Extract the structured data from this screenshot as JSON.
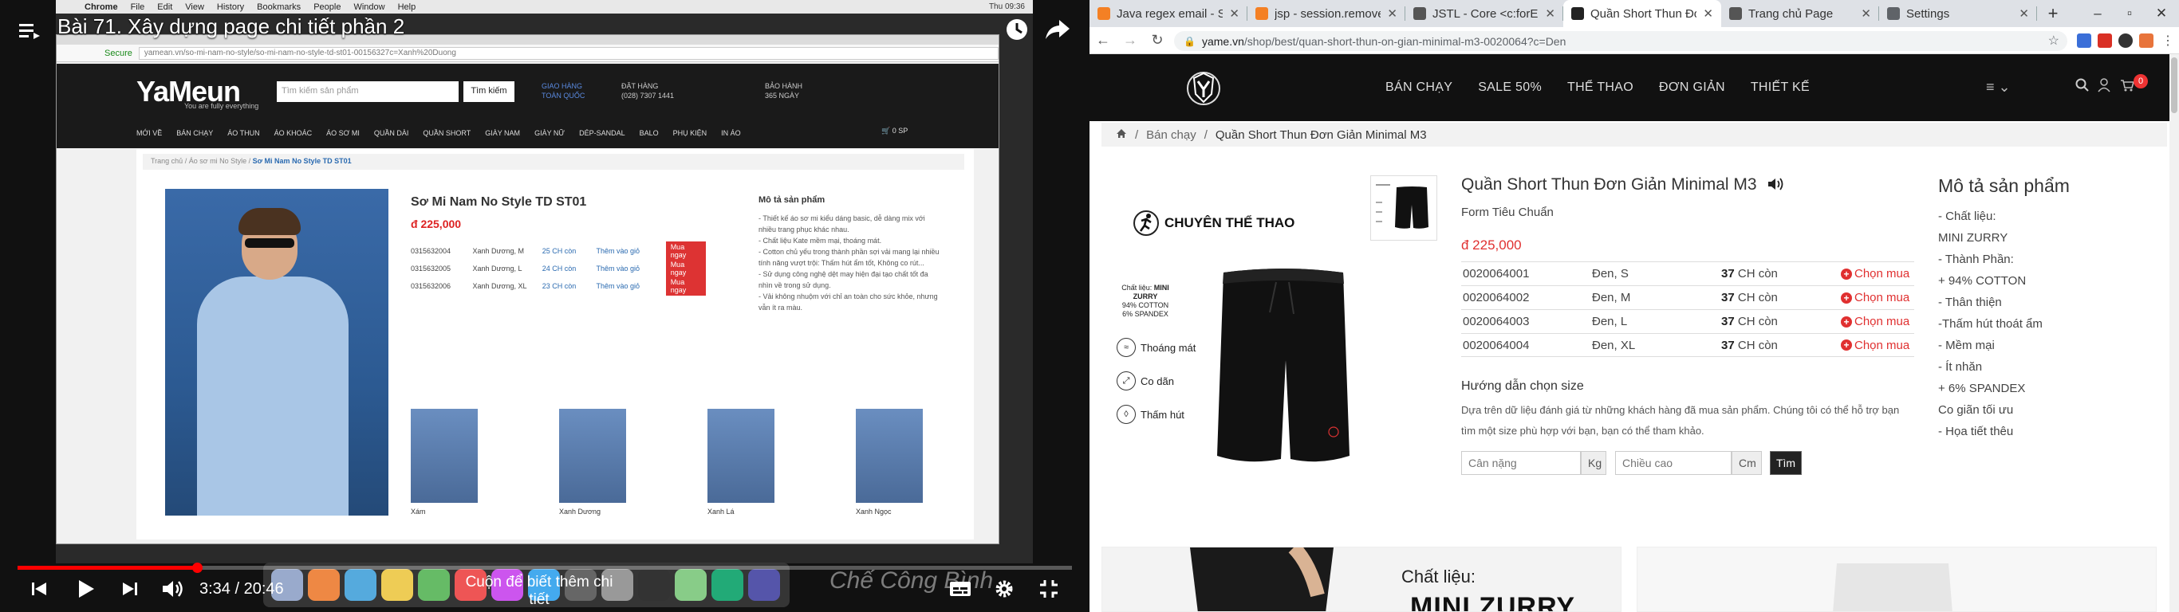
{
  "video": {
    "title": "Bài 71. Xây dựng page chi tiết phần 2",
    "time": "3:34 / 20:46",
    "progress_fraction": 0.17,
    "hint": "Cuộn để biết thêm chi tiết",
    "watermark": "Chế Công Bình",
    "mac_menu": [
      "Chrome",
      "File",
      "Edit",
      "View",
      "History",
      "Bookmarks",
      "People",
      "Window",
      "Help"
    ],
    "mac_clock": "Thu 09:36",
    "url": "yamean.vn/so-mi-nam-no-style/so-mi-nam-no-style-td-st01-00156327c=Xanh%20Duong",
    "secure": "Secure",
    "site": {
      "logo": "YaMeun",
      "tagline": "You are fully everything",
      "search_placeholder": "Tìm kiếm sản phẩm",
      "search_btn": "Tìm kiếm",
      "info": [
        {
          "l1": "GIAO HÀNG",
          "l2": "TOÀN QUỐC"
        },
        {
          "l1": "ĐẶT HÀNG",
          "l2": "(028) 7307 1441"
        },
        {
          "l1": "BẢO HÀNH",
          "l2": "365 NGÀY"
        }
      ],
      "nav": [
        "MỚI VỀ",
        "BÁN CHẠY",
        "ÁO THUN",
        "ÁO KHOÁC",
        "ÁO SƠ MI",
        "QUẦN DÀI",
        "QUẦN SHORT",
        "GIÀY NAM",
        "GIÀY NỮ",
        "DÉP-SANDAL",
        "BALO",
        "PHỤ KIỆN",
        "IN ÁO"
      ],
      "cart": "0 SP",
      "breadcrumb": [
        "Trang chủ",
        "Áo sơ mi No Style",
        "Sơ Mi Nam No Style TD ST01"
      ],
      "product_title": "Sơ Mi Nam No Style TD ST01",
      "price": "đ 225,000",
      "rows": [
        {
          "code": "0315632004",
          "variant": "Xanh Dương, M",
          "stock": "25 CH còn",
          "add": "Thêm vào giỏ",
          "buy": "Mua ngay"
        },
        {
          "code": "0315632005",
          "variant": "Xanh Dương, L",
          "stock": "24 CH còn",
          "add": "Thêm vào giỏ",
          "buy": "Mua ngay"
        },
        {
          "code": "0315632006",
          "variant": "Xanh Dương, XL",
          "stock": "23 CH còn",
          "add": "Thêm vào giỏ",
          "buy": "Mua ngay"
        }
      ],
      "desc_title": "Mô tả sản phẩm",
      "desc_lines": [
        "- Thiết kế áo sơ mi kiểu dáng basic, dễ dàng mix với nhiều trang phục khác nhau.",
        "- Chất liệu Kate mềm mại, thoáng mát.",
        "- Cotton chủ yếu trong thành phần sợi vải mang lại nhiều tính năng vượt trội: Thấm hút ẩm tốt, Không co rút...",
        "- Sử dụng công nghệ dệt may hiện đại tạo chất tốt đa nhìn về trong sử dụng.",
        "- Vải không nhuộm với chỉ an toàn cho sức khỏe, nhưng vẫn ít ra màu."
      ],
      "thumbs": [
        "Xám",
        "Xanh Dương",
        "Xanh Lá",
        "Xanh Ngọc"
      ]
    }
  },
  "browser": {
    "tabs": [
      {
        "title": "Java regex email - Stack",
        "fav_color": "#f48024",
        "active": false
      },
      {
        "title": "jsp - session.removeAttr",
        "fav_color": "#f48024",
        "active": false
      },
      {
        "title": "JSTL - Core <c:forEach>",
        "fav_color": "#555555",
        "active": false
      },
      {
        "title": "Quần Short Thun Đơn Giản",
        "fav_color": "#222222",
        "active": true
      },
      {
        "title": "Trang chủ Page",
        "fav_color": "#555555",
        "active": false
      },
      {
        "title": "Settings",
        "fav_color": "#5f6368",
        "active": false
      }
    ],
    "url_host": "yame.vn",
    "url_path": "/shop/best/quan-short-thun-on-gian-minimal-m3-0020064?c=Den"
  },
  "site": {
    "nav": [
      "BÁN CHẠY",
      "SALE 50%",
      "THỂ THAO",
      "ĐƠN GIẢN",
      "THIẾT KẾ"
    ],
    "cart_count": "0",
    "breadcrumb": [
      "Bán chạy",
      "Quần Short Thun Đơn Giản Minimal M3"
    ],
    "product": {
      "title": "Quần Short Thun Đơn Giản Minimal M3",
      "subtitle": "Form Tiêu Chuẩn",
      "price": "đ 225,000",
      "variants": [
        {
          "code": "0020064001",
          "variant": "Đen, S",
          "qty": "37",
          "unit": "CH còn",
          "action": "Chọn mua"
        },
        {
          "code": "0020064002",
          "variant": "Đen, M",
          "qty": "37",
          "unit": "CH còn",
          "action": "Chọn mua"
        },
        {
          "code": "0020064003",
          "variant": "Đen, L",
          "qty": "37",
          "unit": "CH còn",
          "action": "Chọn mua"
        },
        {
          "code": "0020064004",
          "variant": "Đen, XL",
          "qty": "37",
          "unit": "CH còn",
          "action": "Chọn mua"
        }
      ],
      "image": {
        "heading": "CHUYÊN THỂ THAO",
        "material_label": "Chất liệu:",
        "material_name": "MINI ZURRY",
        "material_l1": "94% COTTON",
        "material_l2": "6% SPANDEX",
        "features": [
          "Thoáng mát",
          "Co dãn",
          "Thấm hút"
        ]
      }
    },
    "size_guide": {
      "title": "Hướng dẫn chọn size",
      "text": "Dựa trên dữ liệu đánh giá từ những khách hàng đã mua sản phẩm. Chúng tôi có thể hỗ trợ bạn tìm một size phù hợp với bạn, bạn có thể tham khảo.",
      "weight_placeholder": "Cân nặng",
      "weight_unit": "Kg",
      "height_placeholder": "Chiều cao",
      "height_unit": "Cm",
      "find_btn": "Tìm"
    },
    "description": {
      "title": "Mô tả sản phẩm",
      "lines": [
        "- Chất liệu:",
        "MINI ZURRY",
        "- Thành Phần:",
        "+ 94% COTTON",
        "- Thân thiện",
        "-Thấm hút thoát ẩm",
        "- Mềm mại",
        "- Ít nhăn",
        "+ 6% SPANDEX",
        "Co giãn tối ưu",
        "- Họa tiết thêu"
      ]
    },
    "banner": {
      "label": "Chất liệu:",
      "name": "MINI ZURRY"
    }
  }
}
